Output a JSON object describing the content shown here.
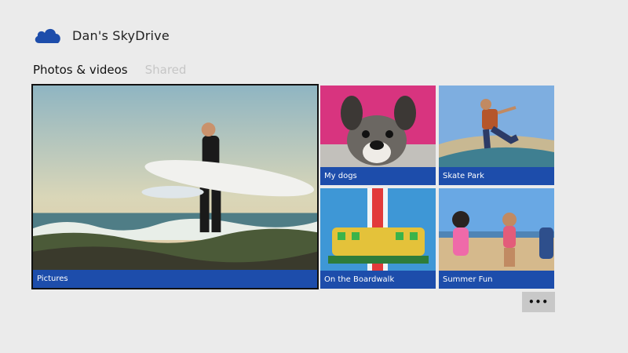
{
  "header": {
    "title": "Dan's SkyDrive",
    "icon": "cloud-icon",
    "icon_color": "#1d4dab"
  },
  "tabs": [
    {
      "label": "Photos & videos",
      "active": true
    },
    {
      "label": "Shared",
      "active": false
    }
  ],
  "tiles": [
    {
      "label": "Pictures"
    },
    {
      "label": "My dogs"
    },
    {
      "label": "Skate Park"
    },
    {
      "label": "On the Boardwalk"
    },
    {
      "label": "Summer Fun"
    }
  ],
  "more_button": {
    "label": "•••",
    "icon": "more-icon"
  },
  "accent_color": "#1d4dab"
}
